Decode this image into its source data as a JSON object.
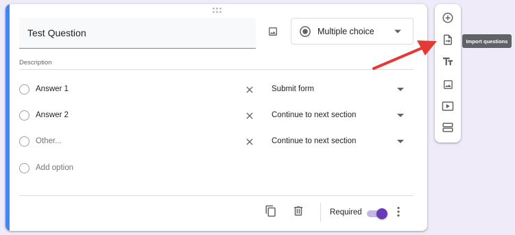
{
  "question": {
    "title": "Test Question",
    "type": "Multiple choice",
    "description_label": "Description"
  },
  "options": [
    {
      "label": "Answer 1",
      "goto": "Submit form",
      "muted": false
    },
    {
      "label": "Answer 2",
      "goto": "Continue to next section",
      "muted": false
    },
    {
      "label": "Other...",
      "goto": "Continue to next section",
      "muted": true
    }
  ],
  "add_option": "Add option",
  "footer": {
    "required_label": "Required",
    "required_on": true
  },
  "side_toolbar": {
    "tooltip": "Import questions",
    "tools": [
      "add-question-icon",
      "import-questions-icon",
      "add-title-icon",
      "add-image-icon",
      "add-video-icon",
      "add-section-icon"
    ]
  },
  "colors": {
    "accent": "#4285f4",
    "toggle": "#673ab7",
    "arrow": "#e53935",
    "background": "#f0ebf8"
  }
}
